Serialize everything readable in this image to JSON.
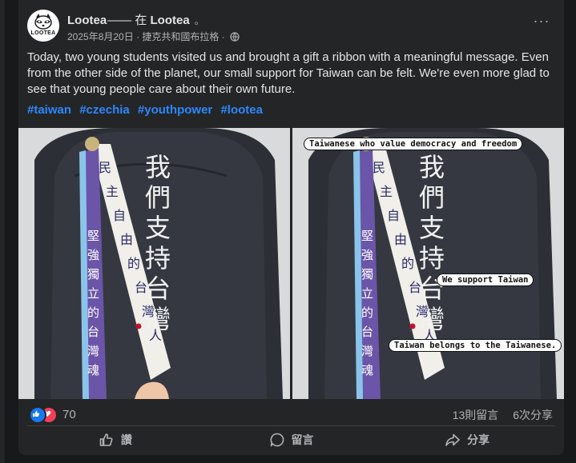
{
  "post": {
    "author": "Lootea",
    "location_sep": "—— 在",
    "location": "Lootea",
    "location_dot": "。",
    "date": "2025年8月20日",
    "place": "捷克共和國布拉格",
    "dot_sep": "·",
    "more_label": "···",
    "avatar_text": "LOOTEA",
    "body": "Today, two young students visited us and brought a gift a ribbon with a meaningful message. Even from the other side of the planet, our small support for Taiwan can be felt. We're even more glad to see that young people care about their own future.",
    "hashtags": [
      "#taiwan",
      "#czechia",
      "#youthpower",
      "#lootea"
    ]
  },
  "photos": {
    "hoodie_text": [
      "我",
      "們",
      "支",
      "持",
      "台",
      "灣"
    ],
    "ribbon_white_text": [
      "民",
      "主",
      "自",
      "由",
      "的",
      "台",
      "灣",
      "人"
    ],
    "ribbon_purple_text": [
      "堅",
      "強",
      "獨",
      "立",
      "的",
      "台",
      "灣",
      "魂"
    ],
    "captions": {
      "democracy": "Taiwanese who value democracy and freedom",
      "support": "We support Taiwan",
      "belongs": "Taiwan belongs to the Taiwanese."
    }
  },
  "engagement": {
    "reaction_count": "70",
    "comments": "13則留言",
    "shares": "6次分享"
  },
  "actions": {
    "like": "讚",
    "comment": "留言",
    "share": "分享"
  },
  "colors": {
    "background": "#18191a",
    "card": "#242526",
    "hashtag": "#2d88ff",
    "like_blue": "#1877f2",
    "love_red": "#f33e58",
    "ribbon_purple": "#6a55a8"
  }
}
